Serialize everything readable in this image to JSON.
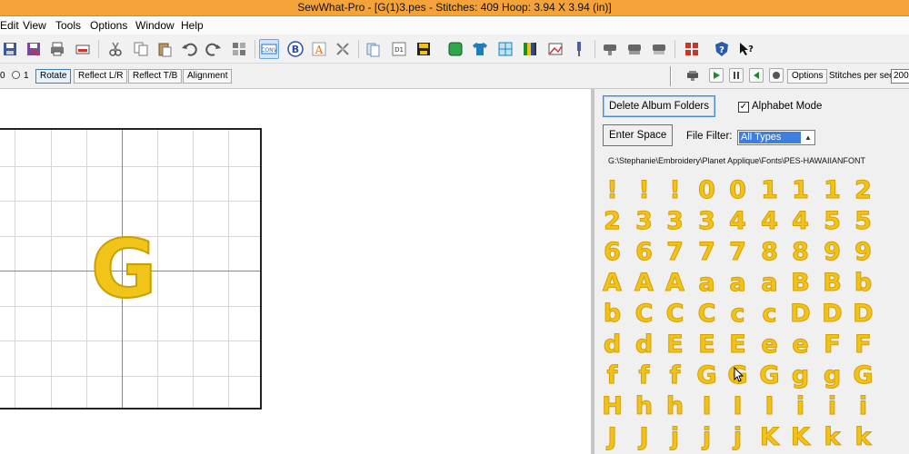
{
  "app": {
    "title": "SewWhat-Pro - [G(1)3.pes - Stitches:  409  Hoop: 3.94 X 3.94 (in)]"
  },
  "menu": [
    "Edit",
    "View",
    "Tools",
    "Options",
    "Window",
    "Help"
  ],
  "toolbar": {
    "icons": [
      "save-icon",
      "save-as-icon",
      "print-icon",
      "print-preview-icon",
      "cut-icon",
      "copy-icon",
      "paste-icon",
      "undo-icon",
      "redo-icon",
      "split-icon",
      "convert-icon",
      "b-icon",
      "text-icon",
      "scissors-icon",
      "pages-icon",
      "d1-icon",
      "floppy-icon",
      "stop-icon",
      "shirt-icon",
      "fabric-icon",
      "color-bars-icon",
      "image-icon",
      "needle-icon",
      "machine-1-icon",
      "machine-2-icon",
      "machine-3-icon",
      "layout-icon",
      "help-icon",
      "whats-this-icon"
    ]
  },
  "options_bar": {
    "radio_left": "0",
    "radio_right": "1",
    "rotate": "Rotate",
    "reflect_lr": "Reflect L/R",
    "reflect_tb": "Reflect T/B",
    "alignment": "Alignment",
    "options": "Options",
    "stitches_per_sec_label": "Stitches per sec",
    "stitches_per_sec_value": "200"
  },
  "canvas": {
    "design_letter": "G"
  },
  "panel": {
    "delete_button": "Delete Album Folders",
    "alphabet_mode_label": "Alphabet Mode",
    "alphabet_mode_checked": true,
    "enter_space_button": "Enter Space",
    "file_filter_label": "File Filter:",
    "file_filter_value": "All Types",
    "path": "G:\\Stephanie\\Embroidery\\Planet Applique\\Fonts\\PES-HAWAIIANFONT",
    "glyph_rows": [
      [
        "!",
        "!",
        "!",
        "0",
        "0",
        "1",
        "1",
        "1",
        "2"
      ],
      [
        "2",
        "3",
        "3",
        "3",
        "4",
        "4",
        "4",
        "5",
        "5"
      ],
      [
        "6",
        "6",
        "7",
        "7",
        "7",
        "8",
        "8",
        "9",
        "9"
      ],
      [
        "A",
        "A",
        "A",
        "a",
        "a",
        "a",
        "B",
        "B",
        "b"
      ],
      [
        "b",
        "C",
        "C",
        "C",
        "c",
        "c",
        "D",
        "D",
        "D"
      ],
      [
        "d",
        "d",
        "E",
        "E",
        "E",
        "e",
        "e",
        "F",
        "F"
      ],
      [
        "f",
        "f",
        "f",
        "G",
        "G",
        "G",
        "g",
        "g",
        "G"
      ],
      [
        "H",
        "h",
        "h",
        "I",
        "I",
        "I",
        "i",
        "i",
        "i"
      ],
      [
        "J",
        "J",
        "j",
        "j",
        "j",
        "K",
        "K",
        "k",
        "k"
      ]
    ]
  },
  "colors": {
    "title_bar": "#f3a33a",
    "thread_gold": "#f2c21a",
    "selection_blue": "#3d7ee0"
  }
}
